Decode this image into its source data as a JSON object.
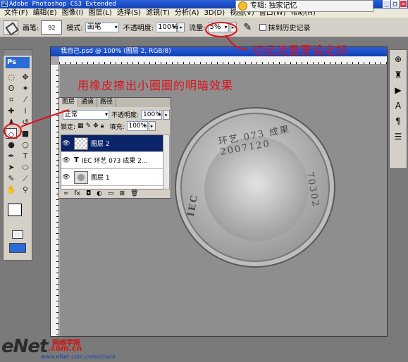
{
  "window": {
    "title": "Adobe Photoshop CS3 Extended",
    "ps_badge": "Ps"
  },
  "music_popup": {
    "text": "专辑: 独家记忆"
  },
  "menu": [
    "文件(F)",
    "编辑(E)",
    "图像(I)",
    "图层(L)",
    "选择(S)",
    "滤镜(T)",
    "分析(A)",
    "3D(D)",
    "视图(V)",
    "窗口(W)",
    "帮助(H)"
  ],
  "options": {
    "brush_label": "画笔:",
    "brush_size": "92",
    "mode_label": "模式:",
    "mode_value": "画笔",
    "opacity_label": "不透明度:",
    "opacity_value": "100%",
    "flow_label": "流量:",
    "flow_value": "5%",
    "history_label": "抹到历史记录"
  },
  "tools": {
    "ps_label": "Ps"
  },
  "document": {
    "title": "我自己.psd @ 100% (图层 2, RGB/8)"
  },
  "coin": {
    "text_top": "环艺 073 成果 2007120",
    "text_left": "IEC",
    "text_right": "70302"
  },
  "layers_panel": {
    "tabs": [
      "图层",
      "通道",
      "路径"
    ],
    "blend_mode": "正常",
    "opacity_label": "不透明度:",
    "opacity_value": "100%",
    "lock_label": "锁定:",
    "fill_label": "填充:",
    "fill_value": "100%",
    "layers": [
      {
        "name": "图层 2",
        "selected": true
      },
      {
        "name": "IEC 环艺 073 成果 2...",
        "selected": false
      },
      {
        "name": "图层 1",
        "selected": false
      }
    ]
  },
  "annotations": {
    "flow_note": "切记流量要设定好",
    "main_note": "用橡皮擦出小圈圈的明暗效果"
  },
  "watermark": {
    "brand": "eNet",
    "com": ".com.cn",
    "school": "网络学院",
    "url": "www.eNet.com.cn/eschool"
  },
  "colors": {
    "annotation": "#e0101a",
    "title_bar": "#1240b5",
    "selected_layer": "#0a246a"
  }
}
